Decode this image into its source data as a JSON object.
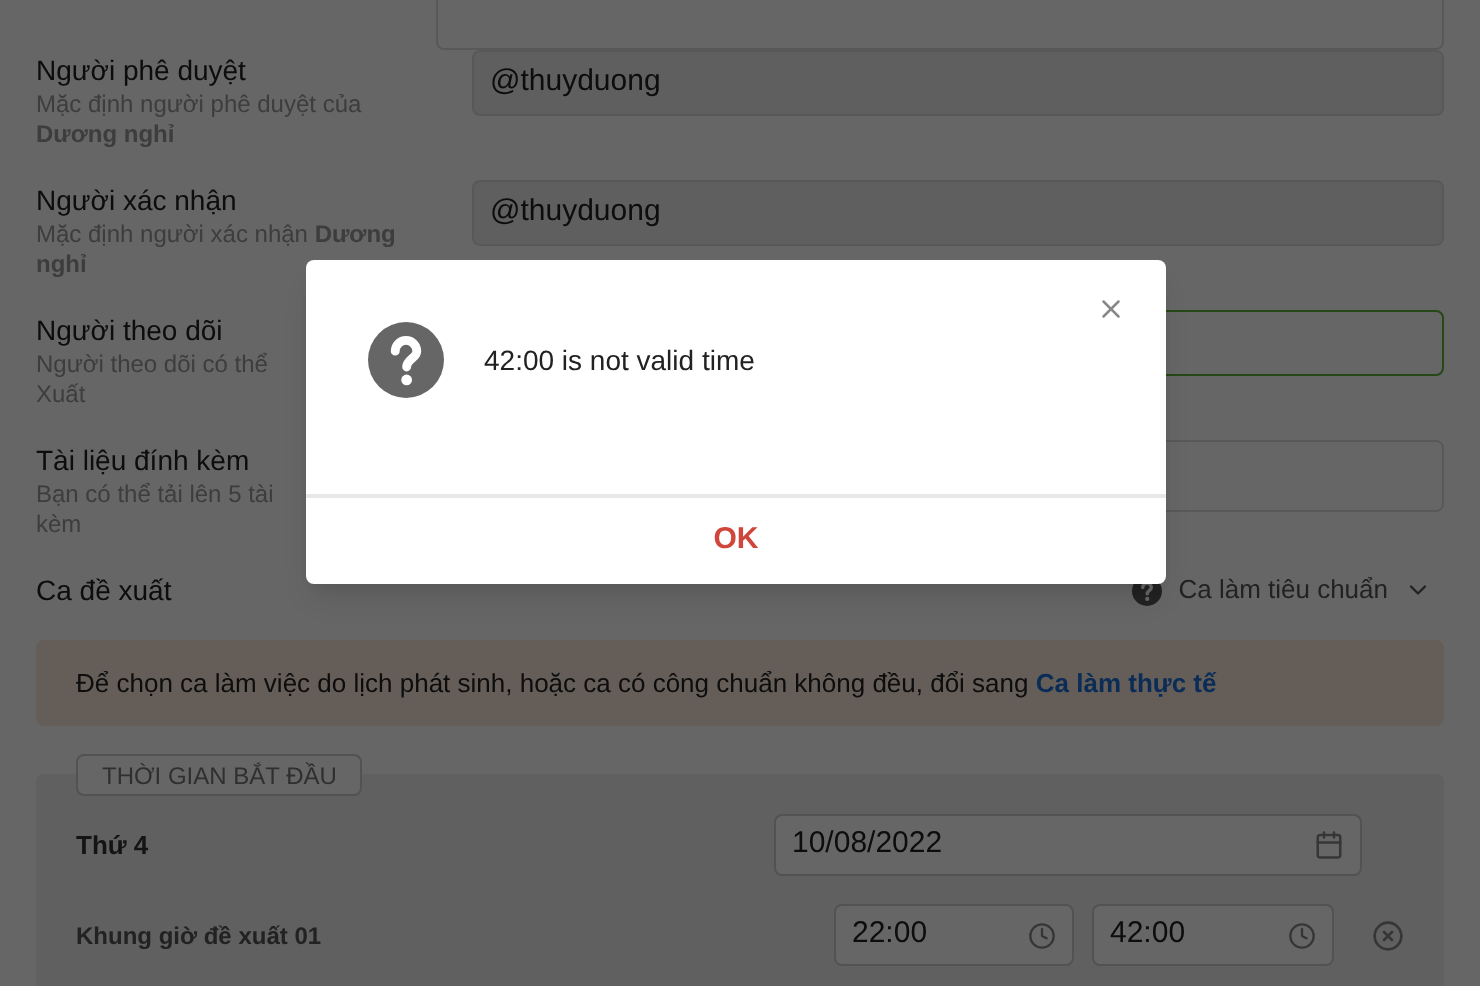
{
  "form": {
    "rows": [
      {
        "kind": "field",
        "label": "Người phê duyệt",
        "description": "Mặc định người phê duyệt của **Dương nghỉ**",
        "value": "@thuyduong",
        "focused": false
      },
      {
        "kind": "field",
        "label": "Người xác nhận",
        "description": "Mặc định người xác nhận **Dương nghỉ**",
        "value": "@thuyduong",
        "focused": false
      },
      {
        "kind": "field",
        "label": "Người theo dõi",
        "description_lines": [
          "Người theo dõi có thể",
          "Xuất"
        ],
        "focused": true
      },
      {
        "kind": "upload",
        "label": "Tài liệu đính kèm",
        "description_lines": [
          "Bạn có thể tải lên 5 tài",
          "kèm"
        ]
      }
    ],
    "shift": {
      "label": "Ca đề xuất",
      "value": "Ca làm tiêu chuẩn"
    },
    "notice": {
      "text": "Để chọn ca làm việc do lịch phát sinh, hoặc ca có công chuẩn không đều, đổi sang",
      "link": "Ca làm thực tế"
    },
    "start_time": {
      "legend": "THỜI GIAN BẮT ĐẦU",
      "day": "Thứ 4",
      "date": "10/08/2022",
      "slot_label": "Khung giờ đề xuất 01",
      "from": "22:00",
      "to": "42:00"
    }
  },
  "dialog": {
    "message": "42:00 is not valid time",
    "button": "OK"
  }
}
